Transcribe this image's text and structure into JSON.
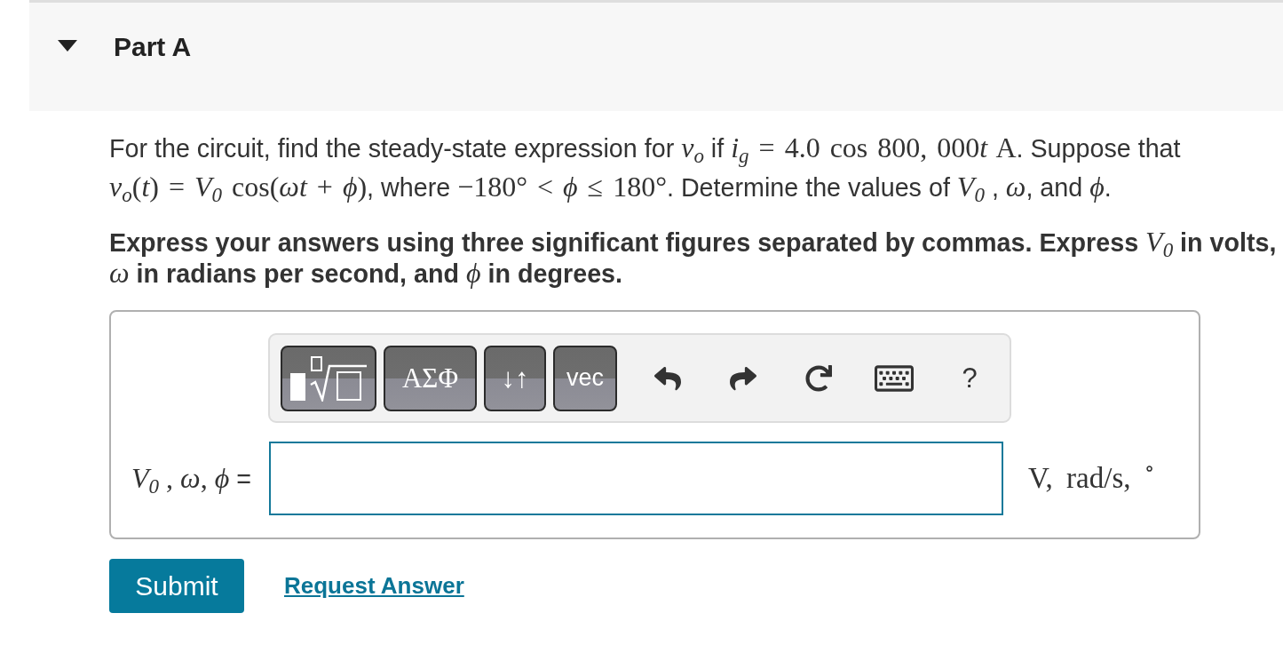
{
  "part": {
    "title": "Part A",
    "expanded": true
  },
  "problem": [
    {
      "kind": "text",
      "text": "For the circuit, find the steady-state expression for "
    },
    {
      "kind": "math",
      "text": "*v*$_{o}$"
    },
    {
      "kind": "text",
      "text": " if "
    },
    {
      "kind": "math",
      "text": "*i*$_{g}$ = 4.0 cos 800, 000"
    },
    {
      "kind": "math",
      "text": "*t* A"
    },
    {
      "kind": "text",
      "text": ". Suppose that "
    },
    {
      "kind": "math",
      "text": "*v*$_{o}$(*t*) = *V*$_{0}$ cos(*ωt* + *ϕ*)"
    },
    {
      "kind": "text",
      "text": ", where "
    },
    {
      "kind": "math",
      "text": "−180° < *ϕ* ≤ 180°"
    },
    {
      "kind": "text",
      "text": ". Determine the values of "
    },
    {
      "kind": "math",
      "text": "*V*$_{0}$"
    },
    {
      "kind": "text",
      "text": " , "
    },
    {
      "kind": "math",
      "text": "*ω*"
    },
    {
      "kind": "text",
      "text": ", and "
    },
    {
      "kind": "math",
      "text": "*ϕ*"
    },
    {
      "kind": "text",
      "text": "."
    }
  ],
  "instructions": [
    {
      "kind": "text",
      "text": "Express your answers using three significant figures separated by commas. Express "
    },
    {
      "kind": "math",
      "text": "*V*$_{0}$"
    },
    {
      "kind": "text",
      "text": " in volts, "
    },
    {
      "kind": "math",
      "text": "*ω*"
    },
    {
      "kind": "text",
      "text": " in radians per second, and "
    },
    {
      "kind": "math",
      "text": "*ϕ*"
    },
    {
      "kind": "text",
      "text": " in degrees."
    }
  ],
  "answer": {
    "toolbar": {
      "buttons": [
        {
          "kind": "templates"
        },
        {
          "kind": "greek",
          "label": "ΑΣΦ"
        },
        {
          "kind": "arrows",
          "label": "↓↑"
        },
        {
          "kind": "vector",
          "label": "vec"
        }
      ],
      "actions": [
        {
          "kind": "undo"
        },
        {
          "kind": "redo"
        },
        {
          "kind": "reset"
        },
        {
          "kind": "keyboard"
        },
        {
          "kind": "help",
          "label": "?"
        }
      ]
    },
    "label": [
      {
        "kind": "math",
        "text": "*V*$_{0}$ , *ω*, *ϕ*"
      },
      {
        "kind": "text",
        "text": " ="
      }
    ],
    "units": "V, rad/s, $^{∘}$"
  },
  "actions": {
    "submit": "Submit",
    "request": "Request Answer"
  }
}
